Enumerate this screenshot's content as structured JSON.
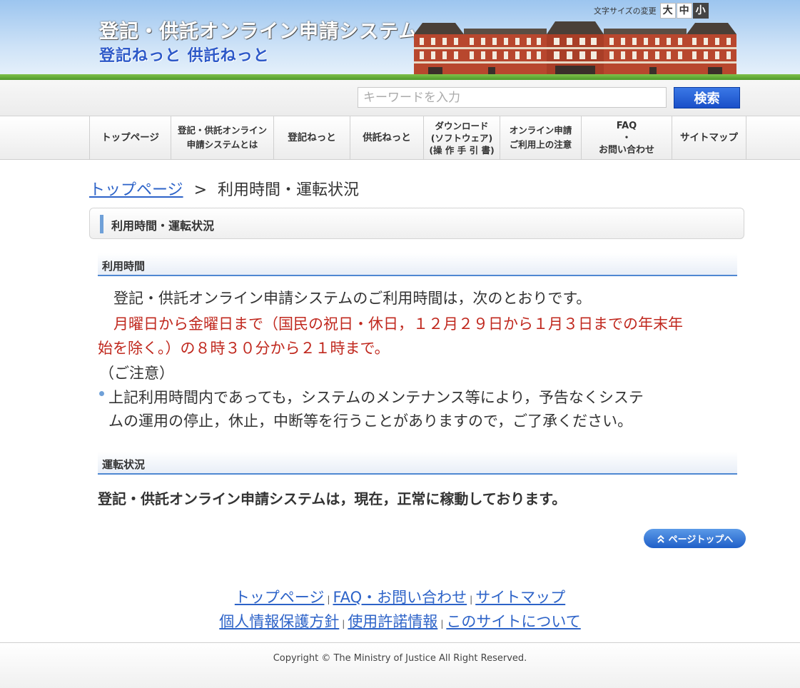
{
  "header": {
    "title": "登記・供託オンライン申請システム",
    "subtitle": "登記ねっと 供託ねっと",
    "font_size_label": "文字サイズの変更",
    "font_sizes": [
      "大",
      "中",
      "小"
    ]
  },
  "search": {
    "placeholder": "キーワードを入力",
    "button": "検索"
  },
  "nav": [
    "トップページ",
    "登記・供託オンライン\n申請システムとは",
    "登記ねっと",
    "供託ねっと",
    "ダウンロード\n(ソフトウェア)\n(操 作 手 引 書)",
    "オンライン申請\nご利用上の注意",
    "FAQ\n・\nお問い合わせ",
    "サイトマップ"
  ],
  "breadcrumb": {
    "home": "トップページ",
    "separator": ">",
    "current": "利用時間・運転状況"
  },
  "page_title": "利用時間・運転状況",
  "usage": {
    "heading": "利用時間",
    "intro": "登記・供託オンライン申請システムのご利用時間は，次のとおりです。",
    "hours_line1": "月曜日から金曜日まで（国民の祝日・休日，１２月２９日から１月３日までの年末年",
    "hours_line2": "始を除く。）の８時３０分から２１時まで。",
    "note_label": "（ご注意）",
    "note_line1": "上記利用時間内であっても，システムのメンテナンス等により，予告なくシステ",
    "note_line2": "ムの運用の停止，休止，中断等を行うことがありますので，ご了承ください。"
  },
  "operation": {
    "heading": "運転状況",
    "status": "登記・供託オンライン申請システムは，現在，正常に稼動しております。"
  },
  "page_top": "ページトップへ",
  "footer": {
    "row1": [
      "トップページ",
      "FAQ・お問い合わせ",
      "サイトマップ"
    ],
    "row2": [
      "個人情報保護方針",
      "使用許諾情報",
      "このサイトについて"
    ],
    "separator": "|",
    "copyright": "Copyright © The Ministry of Justice All Right Reserved."
  },
  "colors": {
    "link": "#2d63c8",
    "accent": "#4f88d2",
    "notice": "#c0281e",
    "button": "#1a4fc8"
  }
}
